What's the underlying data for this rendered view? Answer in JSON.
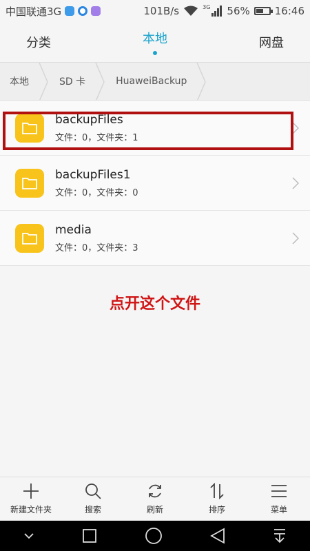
{
  "status_bar": {
    "carrier": "中国联通3G",
    "network_speed": "101B/s",
    "network_type": "3G",
    "battery": "56%",
    "battery_level": 0.56,
    "time": "16:46"
  },
  "tabs": [
    {
      "label": "分类",
      "active": false
    },
    {
      "label": "本地",
      "active": true
    },
    {
      "label": "网盘",
      "active": false
    }
  ],
  "breadcrumb": [
    "本地",
    "SD 卡",
    "HuaweiBackup"
  ],
  "files": [
    {
      "name": "backupFiles",
      "meta": "文件：0，文件夹：1"
    },
    {
      "name": "backupFiles1",
      "meta": "文件：0，文件夹：0"
    },
    {
      "name": "media",
      "meta": "文件：0，文件夹：3"
    }
  ],
  "annotation": "点开这个文件",
  "toolbar": [
    {
      "label": "新建文件夹",
      "icon": "plus-icon"
    },
    {
      "label": "搜索",
      "icon": "search-icon"
    },
    {
      "label": "刷新",
      "icon": "refresh-icon"
    },
    {
      "label": "排序",
      "icon": "sort-icon"
    },
    {
      "label": "菜单",
      "icon": "menu-icon"
    }
  ],
  "colors": {
    "accent": "#1aa3cc",
    "folder": "#f8c41c",
    "annotation": "#d01515",
    "highlight": "#b01010"
  }
}
